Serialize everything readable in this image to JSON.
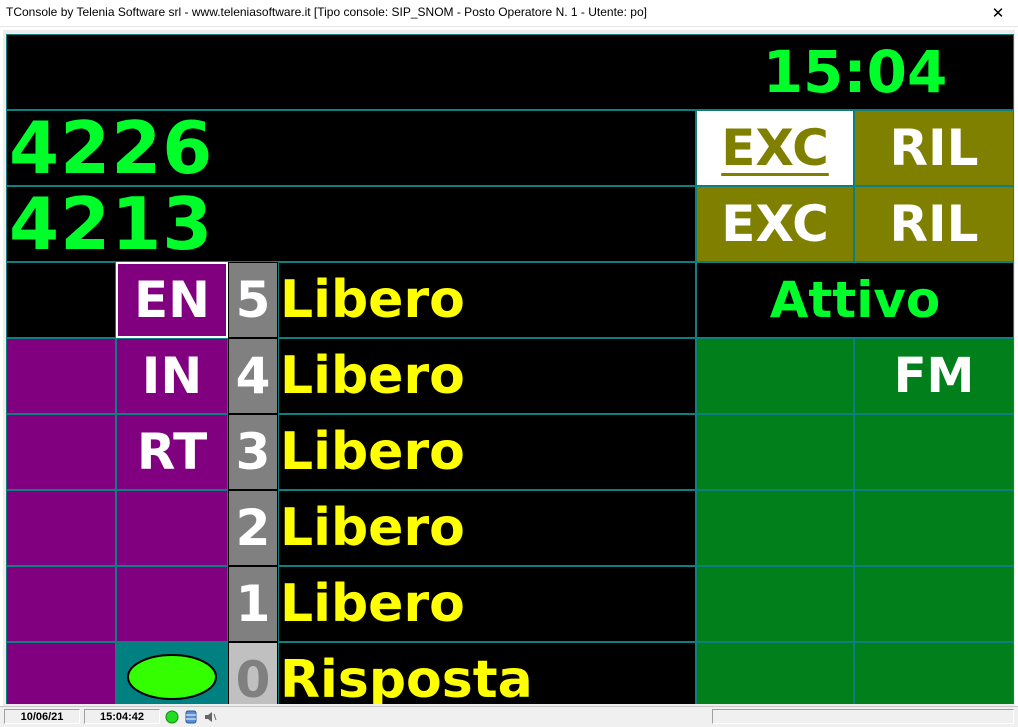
{
  "window": {
    "title": "TConsole by Telenia Software srl - www.teleniasoftware.it    [Tipo console: SIP_SNOM - Posto Operatore N. 1 - Utente: po]",
    "close_glyph": "✕"
  },
  "clock": "15:04",
  "lines": [
    {
      "number": "4226",
      "exc_label": "EXC",
      "ril_label": "RIL"
    },
    {
      "number": "4213",
      "exc_label": "EXC",
      "ril_label": "RIL"
    }
  ],
  "mode_buttons": {
    "en": "EN",
    "in": "IN",
    "rt": "RT"
  },
  "slots": [
    {
      "digit": "5",
      "status": "Libero"
    },
    {
      "digit": "4",
      "status": "Libero"
    },
    {
      "digit": "3",
      "status": "Libero"
    },
    {
      "digit": "2",
      "status": "Libero"
    },
    {
      "digit": "1",
      "status": "Libero"
    },
    {
      "digit": "0",
      "status": "Risposta"
    }
  ],
  "state_label": "Attivo",
  "fm_label": "FM",
  "colors": {
    "panel_bg": "#000000",
    "clock_green": "#00ff2a",
    "olive": "#808000",
    "purple": "#800080",
    "dark_green": "#007f1a",
    "status_yellow": "#ffff00",
    "teal": "#008080",
    "indicator_green": "#33ff00"
  },
  "statusbar": {
    "date": "10/06/21",
    "time": "15:04:42",
    "icons": [
      "green-status-icon",
      "database-icon",
      "speaker-icon"
    ]
  }
}
